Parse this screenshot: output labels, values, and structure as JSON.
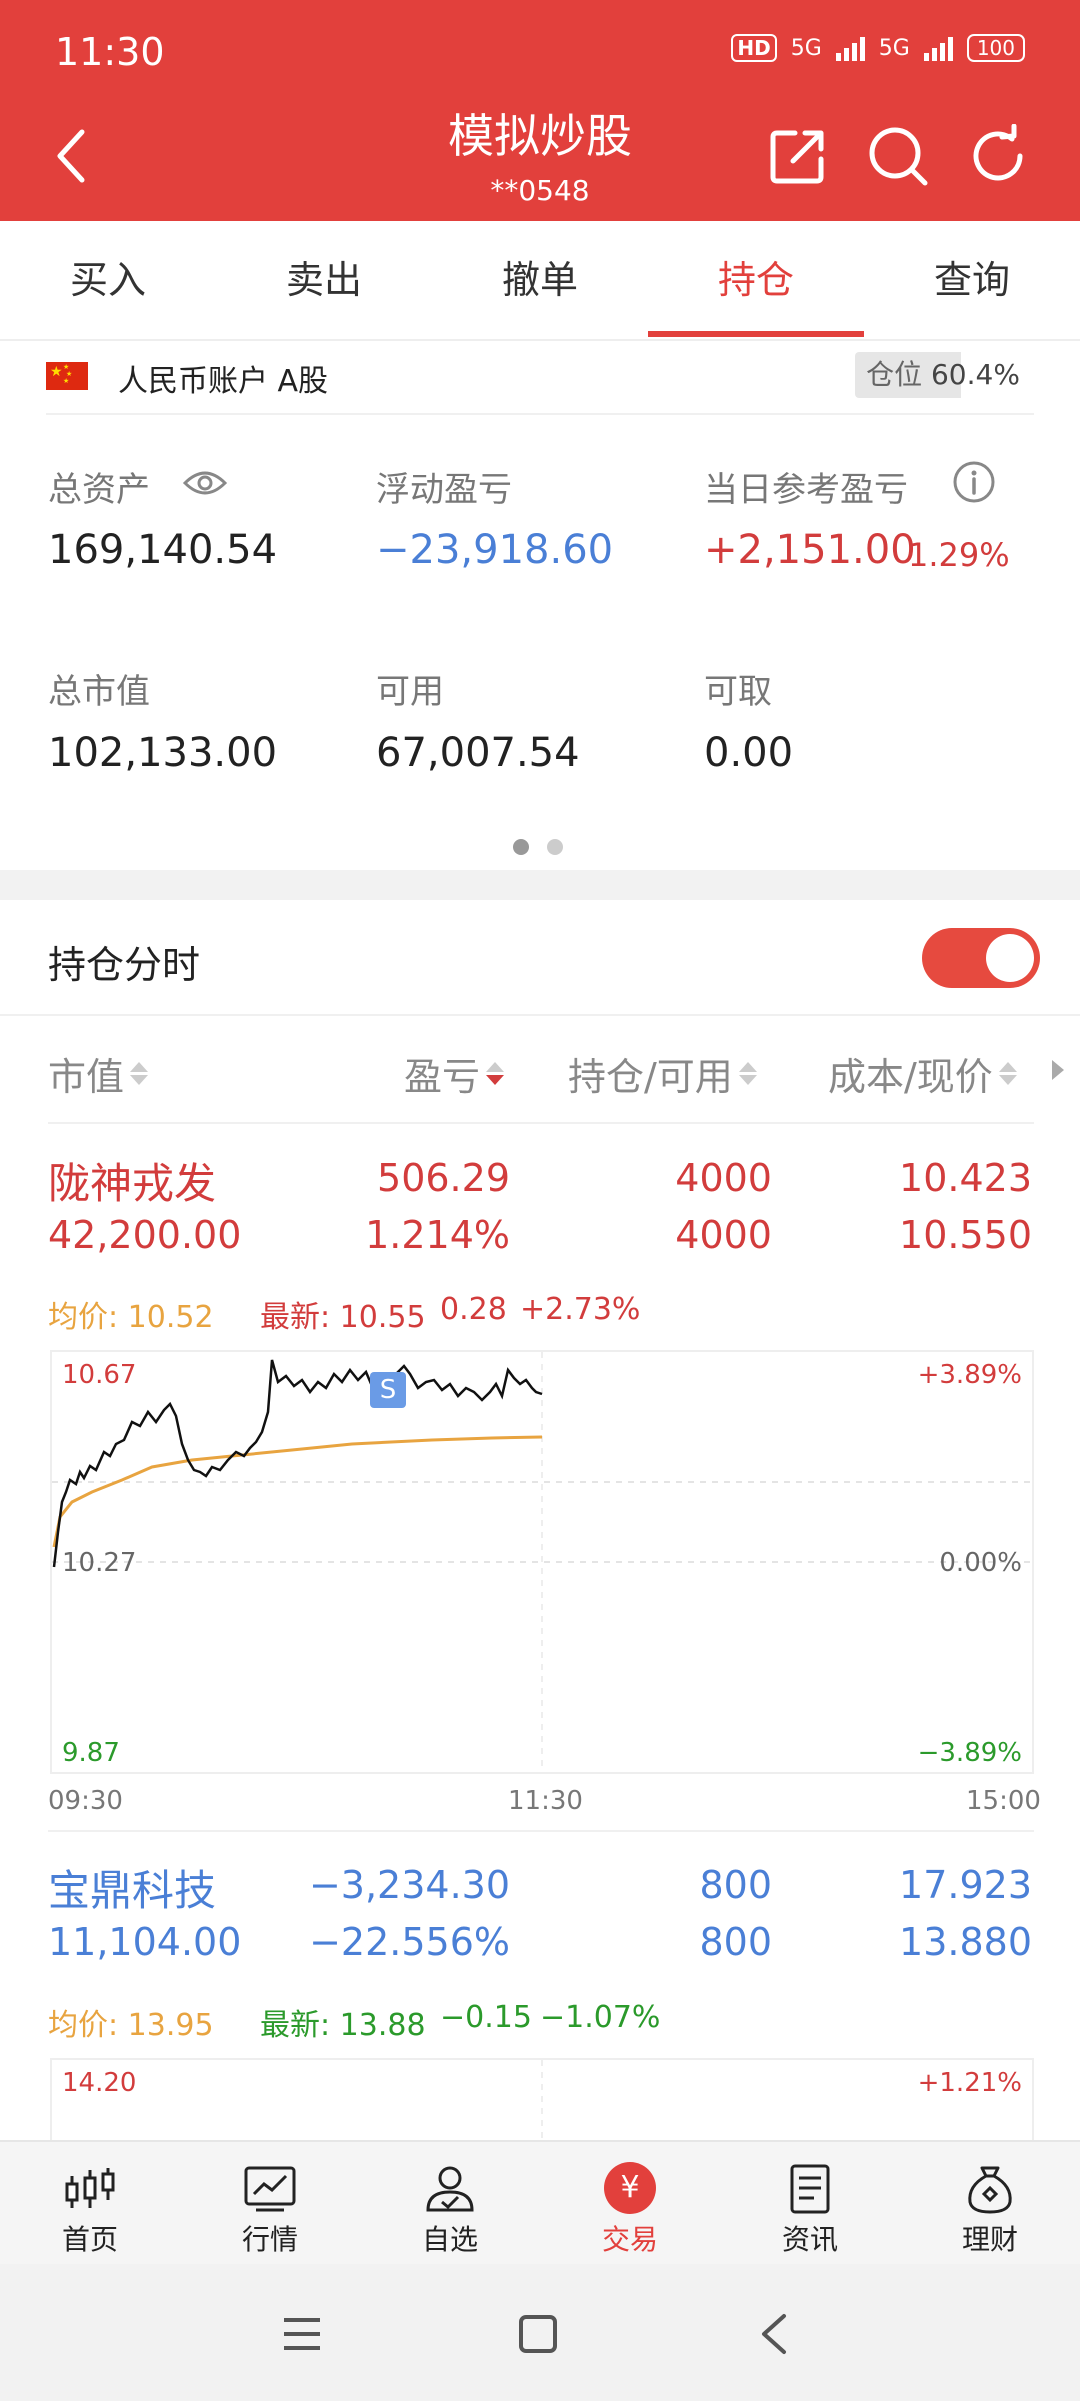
{
  "status_bar": {
    "time": "11:30",
    "hd": "HD",
    "net1": "5G",
    "net2": "5G",
    "battery": "100"
  },
  "header": {
    "title": "模拟炒股",
    "account_masked": "**0548"
  },
  "tabs": [
    {
      "label": "买入"
    },
    {
      "label": "卖出"
    },
    {
      "label": "撤单"
    },
    {
      "label": "持仓",
      "active": true
    },
    {
      "label": "查询"
    }
  ],
  "account": {
    "label": "人民币账户 A股",
    "position_label": "仓位",
    "position_value": "60.4%",
    "position_fraction": 0.604
  },
  "summary": {
    "total_assets_label": "总资产",
    "total_assets": "169,140.54",
    "floating_pl_label": "浮动盈亏",
    "floating_pl": "−23,918.60",
    "daily_pl_label": "当日参考盈亏",
    "daily_pl": "+2,151.00",
    "daily_pl_pct": "1.29%",
    "market_value_label": "总市值",
    "market_value": "102,133.00",
    "available_label": "可用",
    "available": "67,007.54",
    "withdrawable_label": "可取",
    "withdrawable": "0.00"
  },
  "section": {
    "title": "持仓分时",
    "toggle_on": true
  },
  "columns": {
    "c1": "市值",
    "c2": "盈亏",
    "c3": "持仓/可用",
    "c4": "成本/现价"
  },
  "holdings": [
    {
      "name": "陇神戎发",
      "market_value": "42,200.00",
      "pl": "506.29",
      "pl_pct": "1.214%",
      "holding": "4000",
      "available": "4000",
      "cost": "10.423",
      "price": "10.550",
      "avg_label": "均价: 10.52",
      "latest_label": "最新: 10.55",
      "change": "0.28",
      "change_pct": "+2.73%",
      "chart": {
        "y_max": "10.67",
        "y_mid": "10.27",
        "y_min": "9.87",
        "pct_max": "+3.89%",
        "pct_mid": "0.00%",
        "pct_min": "−3.89%",
        "marker": "S"
      }
    },
    {
      "name": "宝鼎科技",
      "market_value": "11,104.00",
      "pl": "−3,234.30",
      "pl_pct": "−22.556%",
      "holding": "800",
      "available": "800",
      "cost": "17.923",
      "price": "13.880",
      "avg_label": "均价: 13.95",
      "latest_label": "最新: 13.88",
      "change": "−0.15",
      "change_pct": "−1.07%",
      "chart": {
        "y_max": "14.20",
        "pct_max": "+1.21%"
      }
    }
  ],
  "time_axis": {
    "start": "09:30",
    "mid": "11:30",
    "end": "15:00"
  },
  "bottom_nav": [
    {
      "label": "首页"
    },
    {
      "label": "行情"
    },
    {
      "label": "自选"
    },
    {
      "label": "交易",
      "active": true
    },
    {
      "label": "资讯"
    },
    {
      "label": "理财"
    }
  ],
  "trade_badge": "¥"
}
